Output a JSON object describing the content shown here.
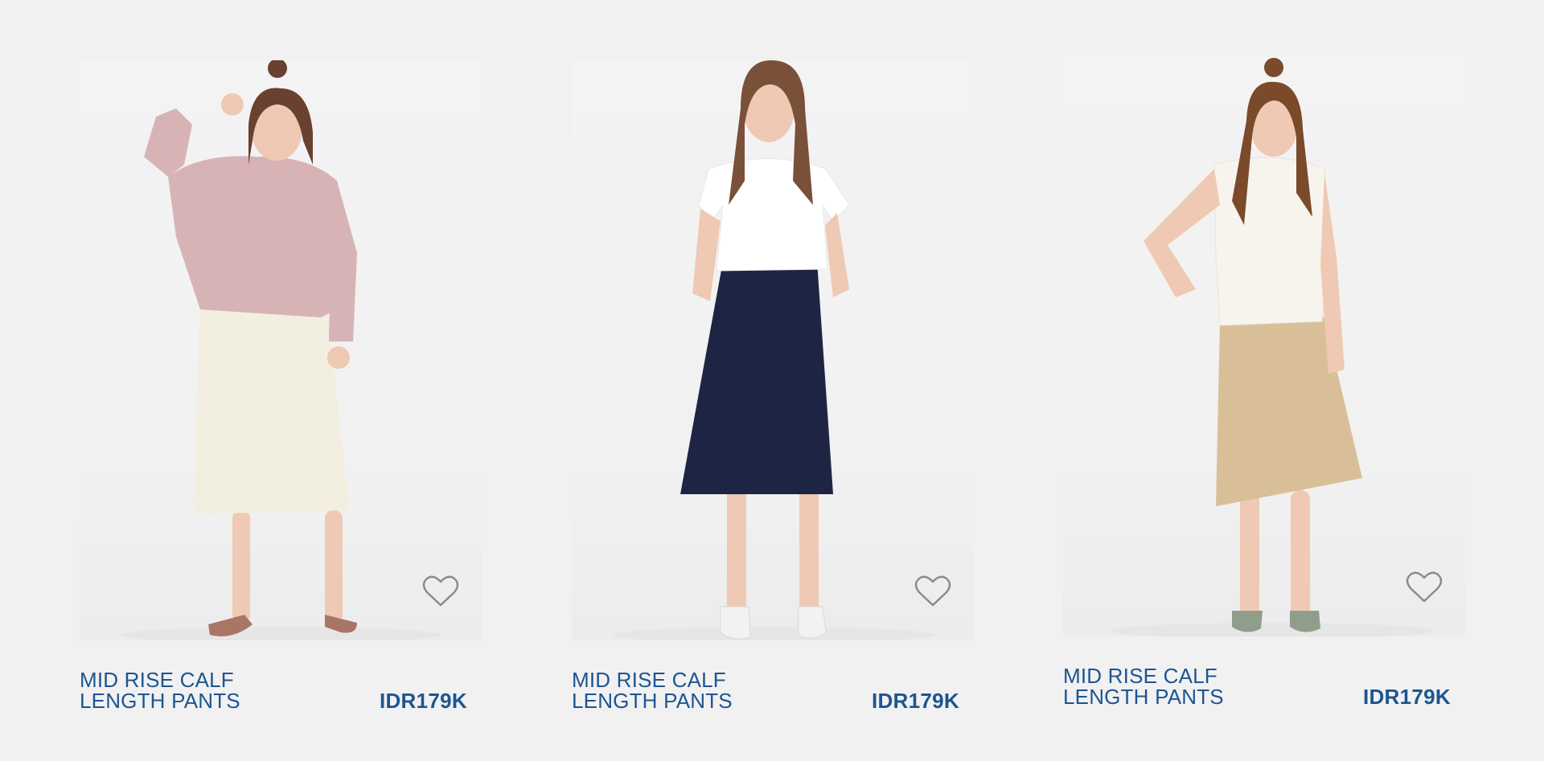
{
  "products": [
    {
      "title": "MID RISE CALF LENGTH PANTS",
      "price": "IDR179K",
      "icon": "heart-outline-icon",
      "colors": {
        "top": "#d8b3b5",
        "bottom": "#f2eee0",
        "shoes": "#a97565"
      }
    },
    {
      "title": "MID RISE CALF LENGTH PANTS",
      "price": "IDR179K",
      "icon": "heart-outline-icon",
      "colors": {
        "top": "#ffffff",
        "bottom": "#1e2443",
        "shoes": "#f2f2f2"
      }
    },
    {
      "title": "MID RISE CALF LENGTH PANTS",
      "price": "IDR179K",
      "icon": "heart-outline-icon",
      "colors": {
        "top": "#f7f4ee",
        "bottom": "#d9bf98",
        "shoes": "#8f9d8a"
      }
    }
  ],
  "theme": {
    "background": "#f1f1f2",
    "text_color": "#1d5591"
  }
}
